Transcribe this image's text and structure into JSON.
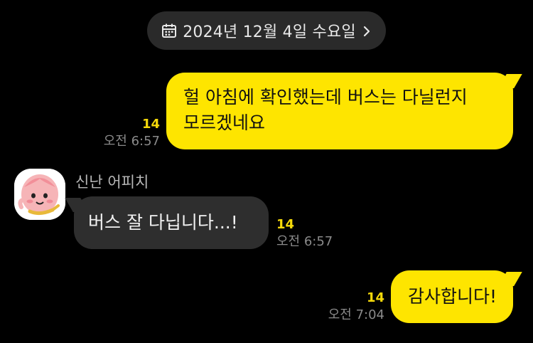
{
  "date_header": {
    "label": "2024년 12월 4일 수요일",
    "icon": "calendar-icon",
    "chevron": "chevron-right-icon"
  },
  "messages": [
    {
      "direction": "outgoing",
      "lines": [
        "헐 아침에 확인했는데 버스는 다닐런지",
        "모르겠네요"
      ],
      "unread": "14",
      "time": "오전 6:57"
    },
    {
      "direction": "incoming",
      "sender": "신난 어피치",
      "avatar": "apeach-avatar",
      "text": "버스 잘 다닙니다...!",
      "unread": "14",
      "time": "오전 6:57"
    },
    {
      "direction": "outgoing",
      "text": "감사합니다!",
      "unread": "14",
      "time": "오전 7:04"
    }
  ],
  "colors": {
    "background": "#000000",
    "outgoing_bubble": "#fee500",
    "incoming_bubble": "#2e2e2e",
    "unread_count": "#f5d90a",
    "date_pill": "#2a2a2a"
  }
}
